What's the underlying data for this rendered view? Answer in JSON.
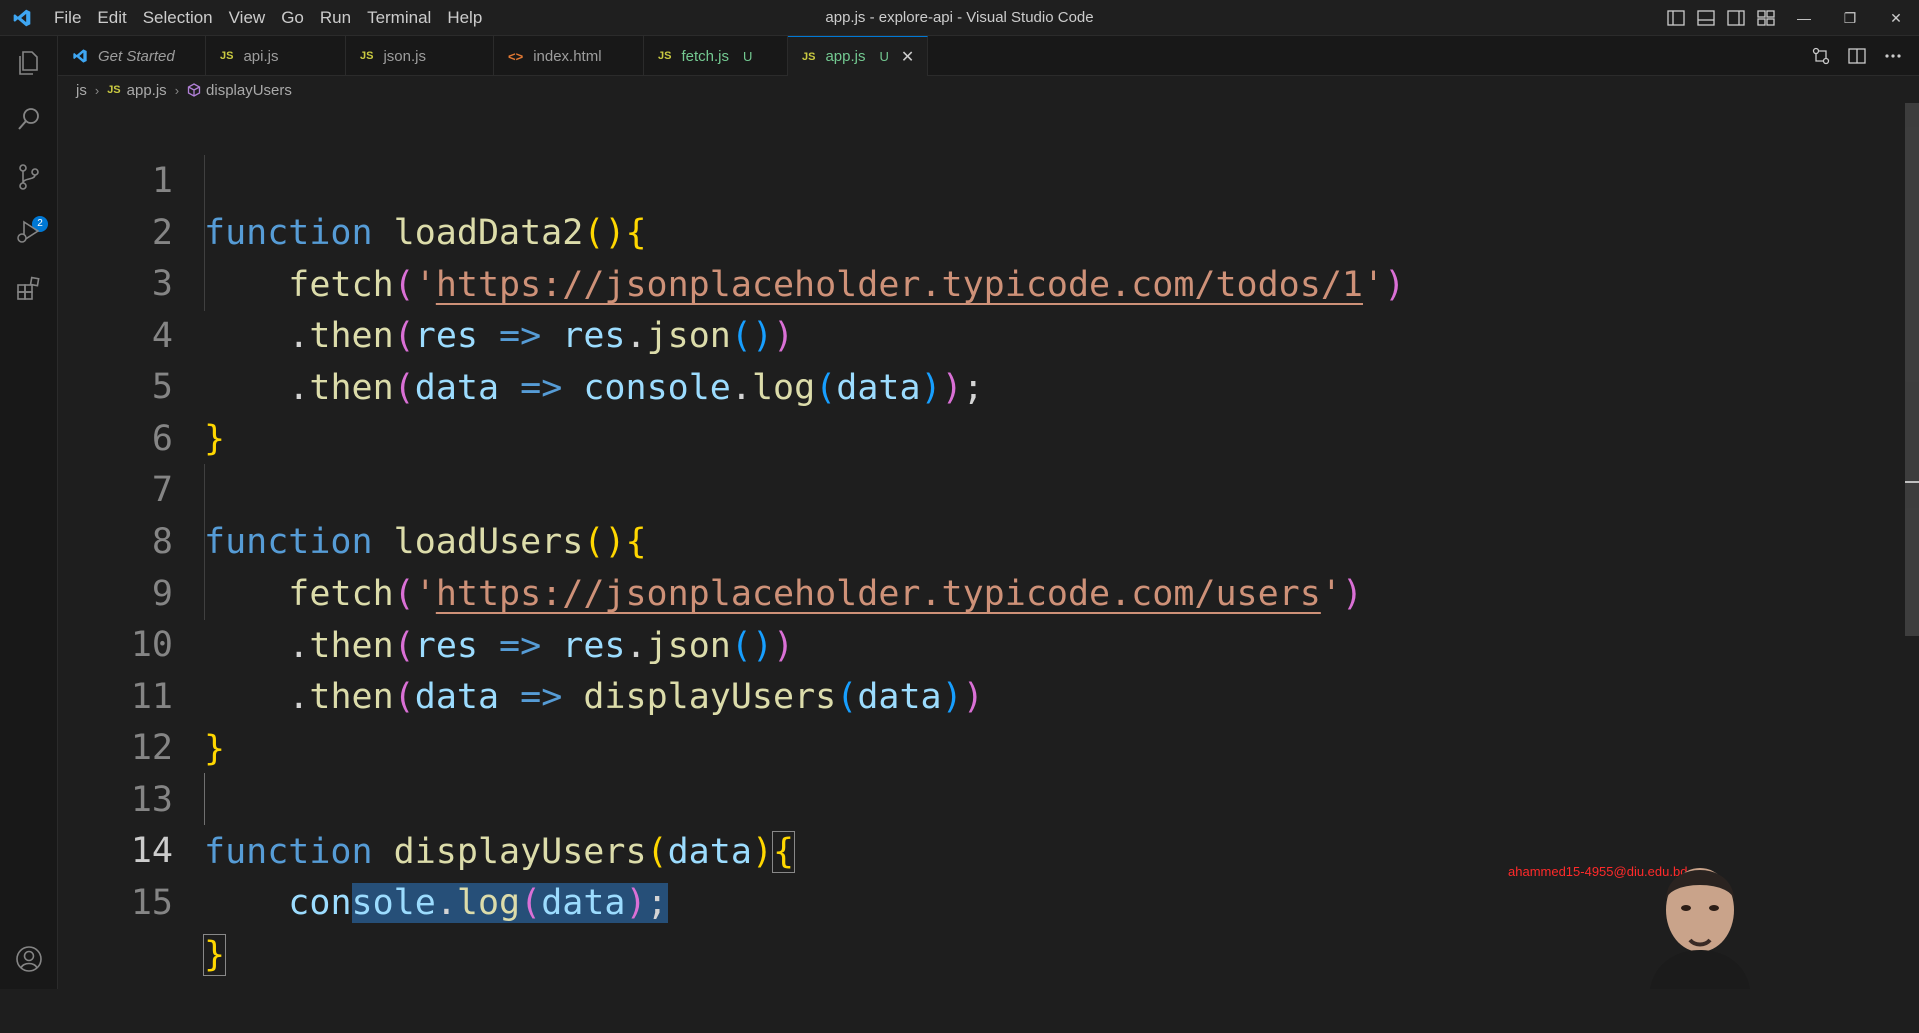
{
  "window": {
    "title": "app.js - explore-api - Visual Studio Code",
    "menu": [
      "File",
      "Edit",
      "Selection",
      "View",
      "Go",
      "Run",
      "Terminal",
      "Help"
    ]
  },
  "activity_bar": {
    "icons": [
      "explorer-icon",
      "search-icon",
      "source-control-icon",
      "run-debug-icon",
      "extensions-icon",
      "account-icon"
    ],
    "scm_badge": "2"
  },
  "tabs": [
    {
      "label": "Get Started",
      "icon": "vscode-icon",
      "status": "",
      "active": false
    },
    {
      "label": "api.js",
      "icon": "JS",
      "status": "",
      "active": false
    },
    {
      "label": "json.js",
      "icon": "JS",
      "status": "",
      "active": false
    },
    {
      "label": "index.html",
      "icon": "<>",
      "status": "",
      "active": false
    },
    {
      "label": "fetch.js",
      "icon": "JS",
      "status": "U",
      "active": false
    },
    {
      "label": "app.js",
      "icon": "JS",
      "status": "U",
      "active": true
    }
  ],
  "breadcrumb": {
    "folder": "js",
    "file": "app.js",
    "symbol": "displayUsers"
  },
  "editor": {
    "current_line": 14,
    "line_numbers": [
      "1",
      "2",
      "3",
      "4",
      "5",
      "6",
      "7",
      "8",
      "9",
      "10",
      "11",
      "12",
      "13",
      "14",
      "15"
    ],
    "lines": [
      "function loadData2(){",
      "    fetch('https://jsonplaceholder.typicode.com/todos/1')",
      "    .then(res => res.json())",
      "    .then(data => console.log(data));",
      "}",
      "",
      "function loadUsers(){",
      "    fetch('https://jsonplaceholder.typicode.com/users')",
      "    .then(res => res.json())",
      "    .then(data => displayUsers(data))",
      "}",
      "",
      "function displayUsers(data){",
      "    console.log(data);",
      "}"
    ]
  },
  "overlay": {
    "watermark": "ahammed15-4955@diu.edu.bd"
  },
  "colors": {
    "keyword": "#569cd6",
    "function": "#dcdcaa",
    "variable": "#9cdcfe",
    "string": "#ce9178",
    "bracket_gold": "#ffd700",
    "bracket_orchid": "#da70d6",
    "bracket_blue": "#179fff",
    "accent": "#0078d4"
  }
}
